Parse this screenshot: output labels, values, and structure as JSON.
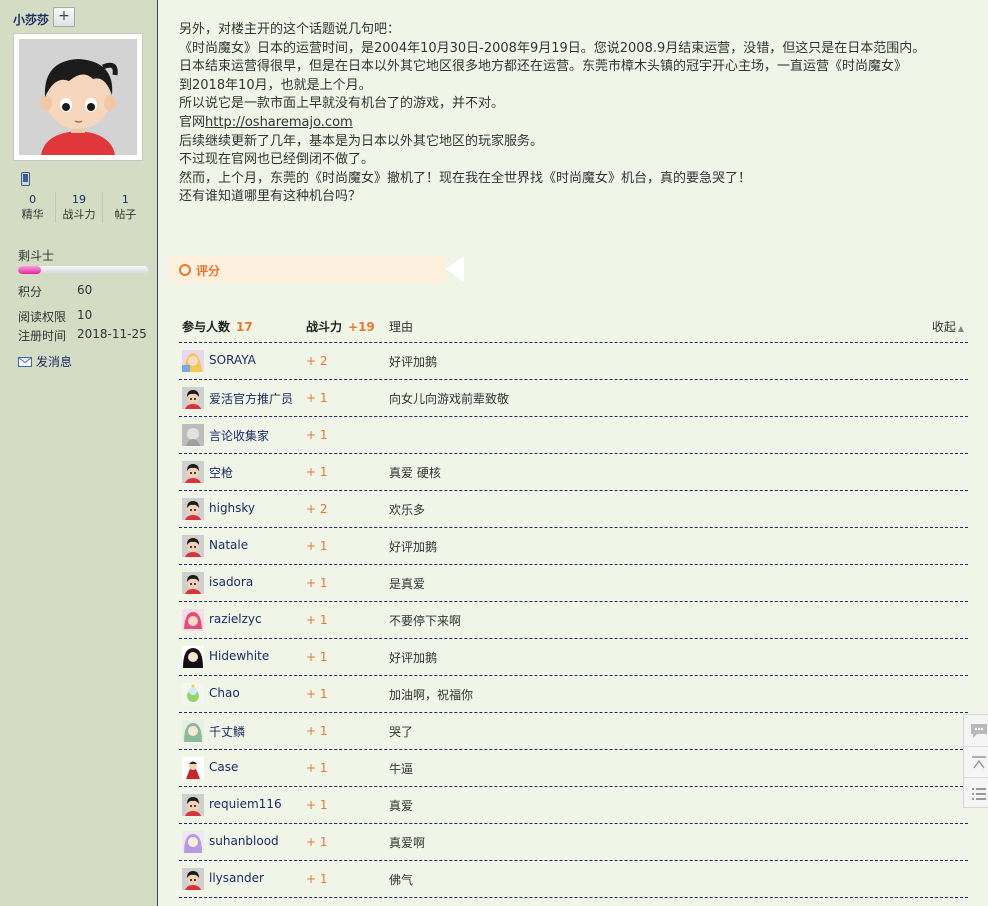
{
  "author": {
    "username": "小莎莎",
    "follow_label": "+",
    "stats": [
      {
        "value": "0",
        "label": "精华"
      },
      {
        "value": "19",
        "label": "战斗力"
      },
      {
        "value": "1",
        "label": "帖子"
      }
    ],
    "rank": "剩斗士",
    "level_progress": 0.18,
    "info": [
      {
        "label": "积分",
        "value": "60"
      },
      {
        "label": "阅读权限",
        "value": "10"
      },
      {
        "label": "注册时间",
        "value": "2018-11-25"
      }
    ],
    "message_label": "发消息"
  },
  "post": {
    "lines": [
      "另外，对楼主开的这个话题说几句吧：",
      "《时尚魔女》日本的运营时间，是2004年10月30日-2008年9月19日。您说2008.9月结束运营，没错，但这只是在日本范围内。",
      "日本结束运营得很早，但是在日本以外其它地区很多地方都还在运营。东莞市樟木头镇的冠宇开心主场，一直运营《时尚魔女》",
      "到2018年10月，也就是上个月。",
      "所以说它是一款市面上早就没有机台了的游戏，并不对。"
    ],
    "official_prefix": "官网",
    "official_link": "http://osharemajo.com",
    "lines_after": [
      "后续继续更新了几年，基本是为日本以外其它地区的玩家服务。",
      "不过现在官网也已经倒闭不做了。",
      "然而，上个月，东莞的《时尚魔女》撤机了！现在我在全世界找《时尚魔女》机台，真的要急哭了！",
      "还有谁知道哪里有这种机台吗？"
    ]
  },
  "rating": {
    "title": "评分",
    "header": {
      "participants_label": "参与人数",
      "participants_count": "17",
      "power_label": "战斗力",
      "power_total": "+19",
      "reason_label": "理由",
      "collapse_label": "收起"
    },
    "rows": [
      {
        "name": "SORAYA",
        "points": "+ 2",
        "reason": "好评加鹅",
        "avatar": "anime-girl"
      },
      {
        "name": "爱活官方推广员",
        "points": "+ 1",
        "reason": "向女儿向游戏前辈致敬",
        "avatar": "default"
      },
      {
        "name": "言论收集家",
        "points": "+ 1",
        "reason": "",
        "avatar": "grey"
      },
      {
        "name": "空枪",
        "points": "+ 1",
        "reason": "真爱 硬核",
        "avatar": "default"
      },
      {
        "name": "highsky",
        "points": "+ 2",
        "reason": "欢乐多",
        "avatar": "default"
      },
      {
        "name": "Natale",
        "points": "+ 1",
        "reason": "好评加鹅",
        "avatar": "default"
      },
      {
        "name": "isadora",
        "points": "+ 1",
        "reason": "是真爱",
        "avatar": "default"
      },
      {
        "name": "razielzyc",
        "points": "+ 1",
        "reason": "不要停下来啊",
        "avatar": "pink-girl"
      },
      {
        "name": "Hidewhite",
        "points": "+ 1",
        "reason": "好评加鹅",
        "avatar": "dark-hair"
      },
      {
        "name": "Chao",
        "points": "+ 1",
        "reason": "加油啊，祝福你",
        "avatar": "chao"
      },
      {
        "name": "千丈鳞",
        "points": "+ 1",
        "reason": "哭了",
        "avatar": "green-hair"
      },
      {
        "name": "Case",
        "points": "+ 1",
        "reason": "牛逼",
        "avatar": "red-char"
      },
      {
        "name": "requiem116",
        "points": "+ 1",
        "reason": "真爱",
        "avatar": "default"
      },
      {
        "name": "suhanblood",
        "points": "+ 1",
        "reason": "真爱啊",
        "avatar": "purple-hair"
      },
      {
        "name": "llysander",
        "points": "+ 1",
        "reason": "佛气",
        "avatar": "default"
      }
    ]
  },
  "float_tools": [
    "comment-icon",
    "back-to-top-icon",
    "list-icon"
  ]
}
